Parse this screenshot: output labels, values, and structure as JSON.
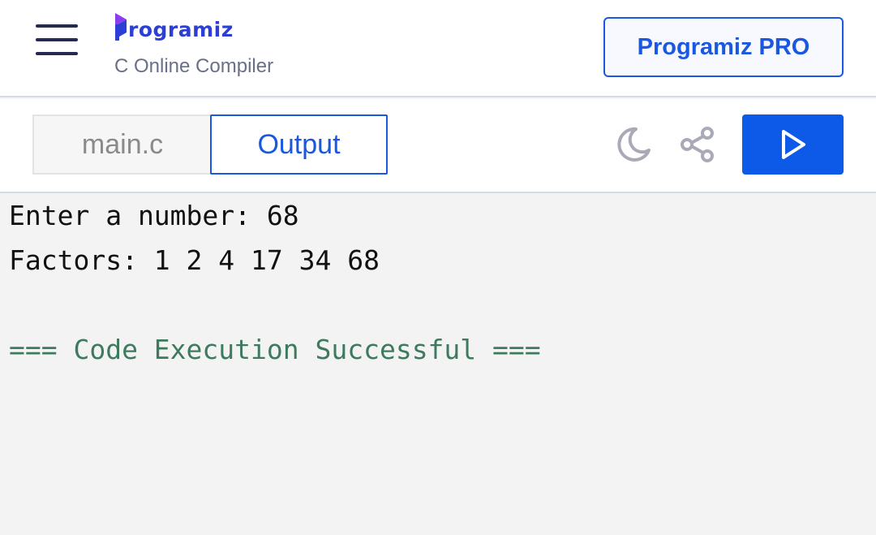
{
  "header": {
    "brand": "Programiz",
    "brand_rest": "rogramiz",
    "subtitle": "C Online Compiler",
    "pro_button": "Programiz PRO",
    "menu_icon": "hamburger-menu-icon"
  },
  "toolbar": {
    "tabs": [
      {
        "label": "main.c",
        "active": false
      },
      {
        "label": "Output",
        "active": true
      }
    ],
    "theme_icon": "moon-icon",
    "share_icon": "share-icon",
    "run_icon": "play-icon"
  },
  "console": {
    "lines": [
      "Enter a number: 68",
      "Factors: 1 2 4 17 34 68",
      "",
      "=== Code Execution Successful ==="
    ]
  },
  "colors": {
    "accent": "#0d5ae8",
    "brand": "#2c3fd4",
    "success_text": "#3d7a5e",
    "background": "#f3f3f3"
  }
}
